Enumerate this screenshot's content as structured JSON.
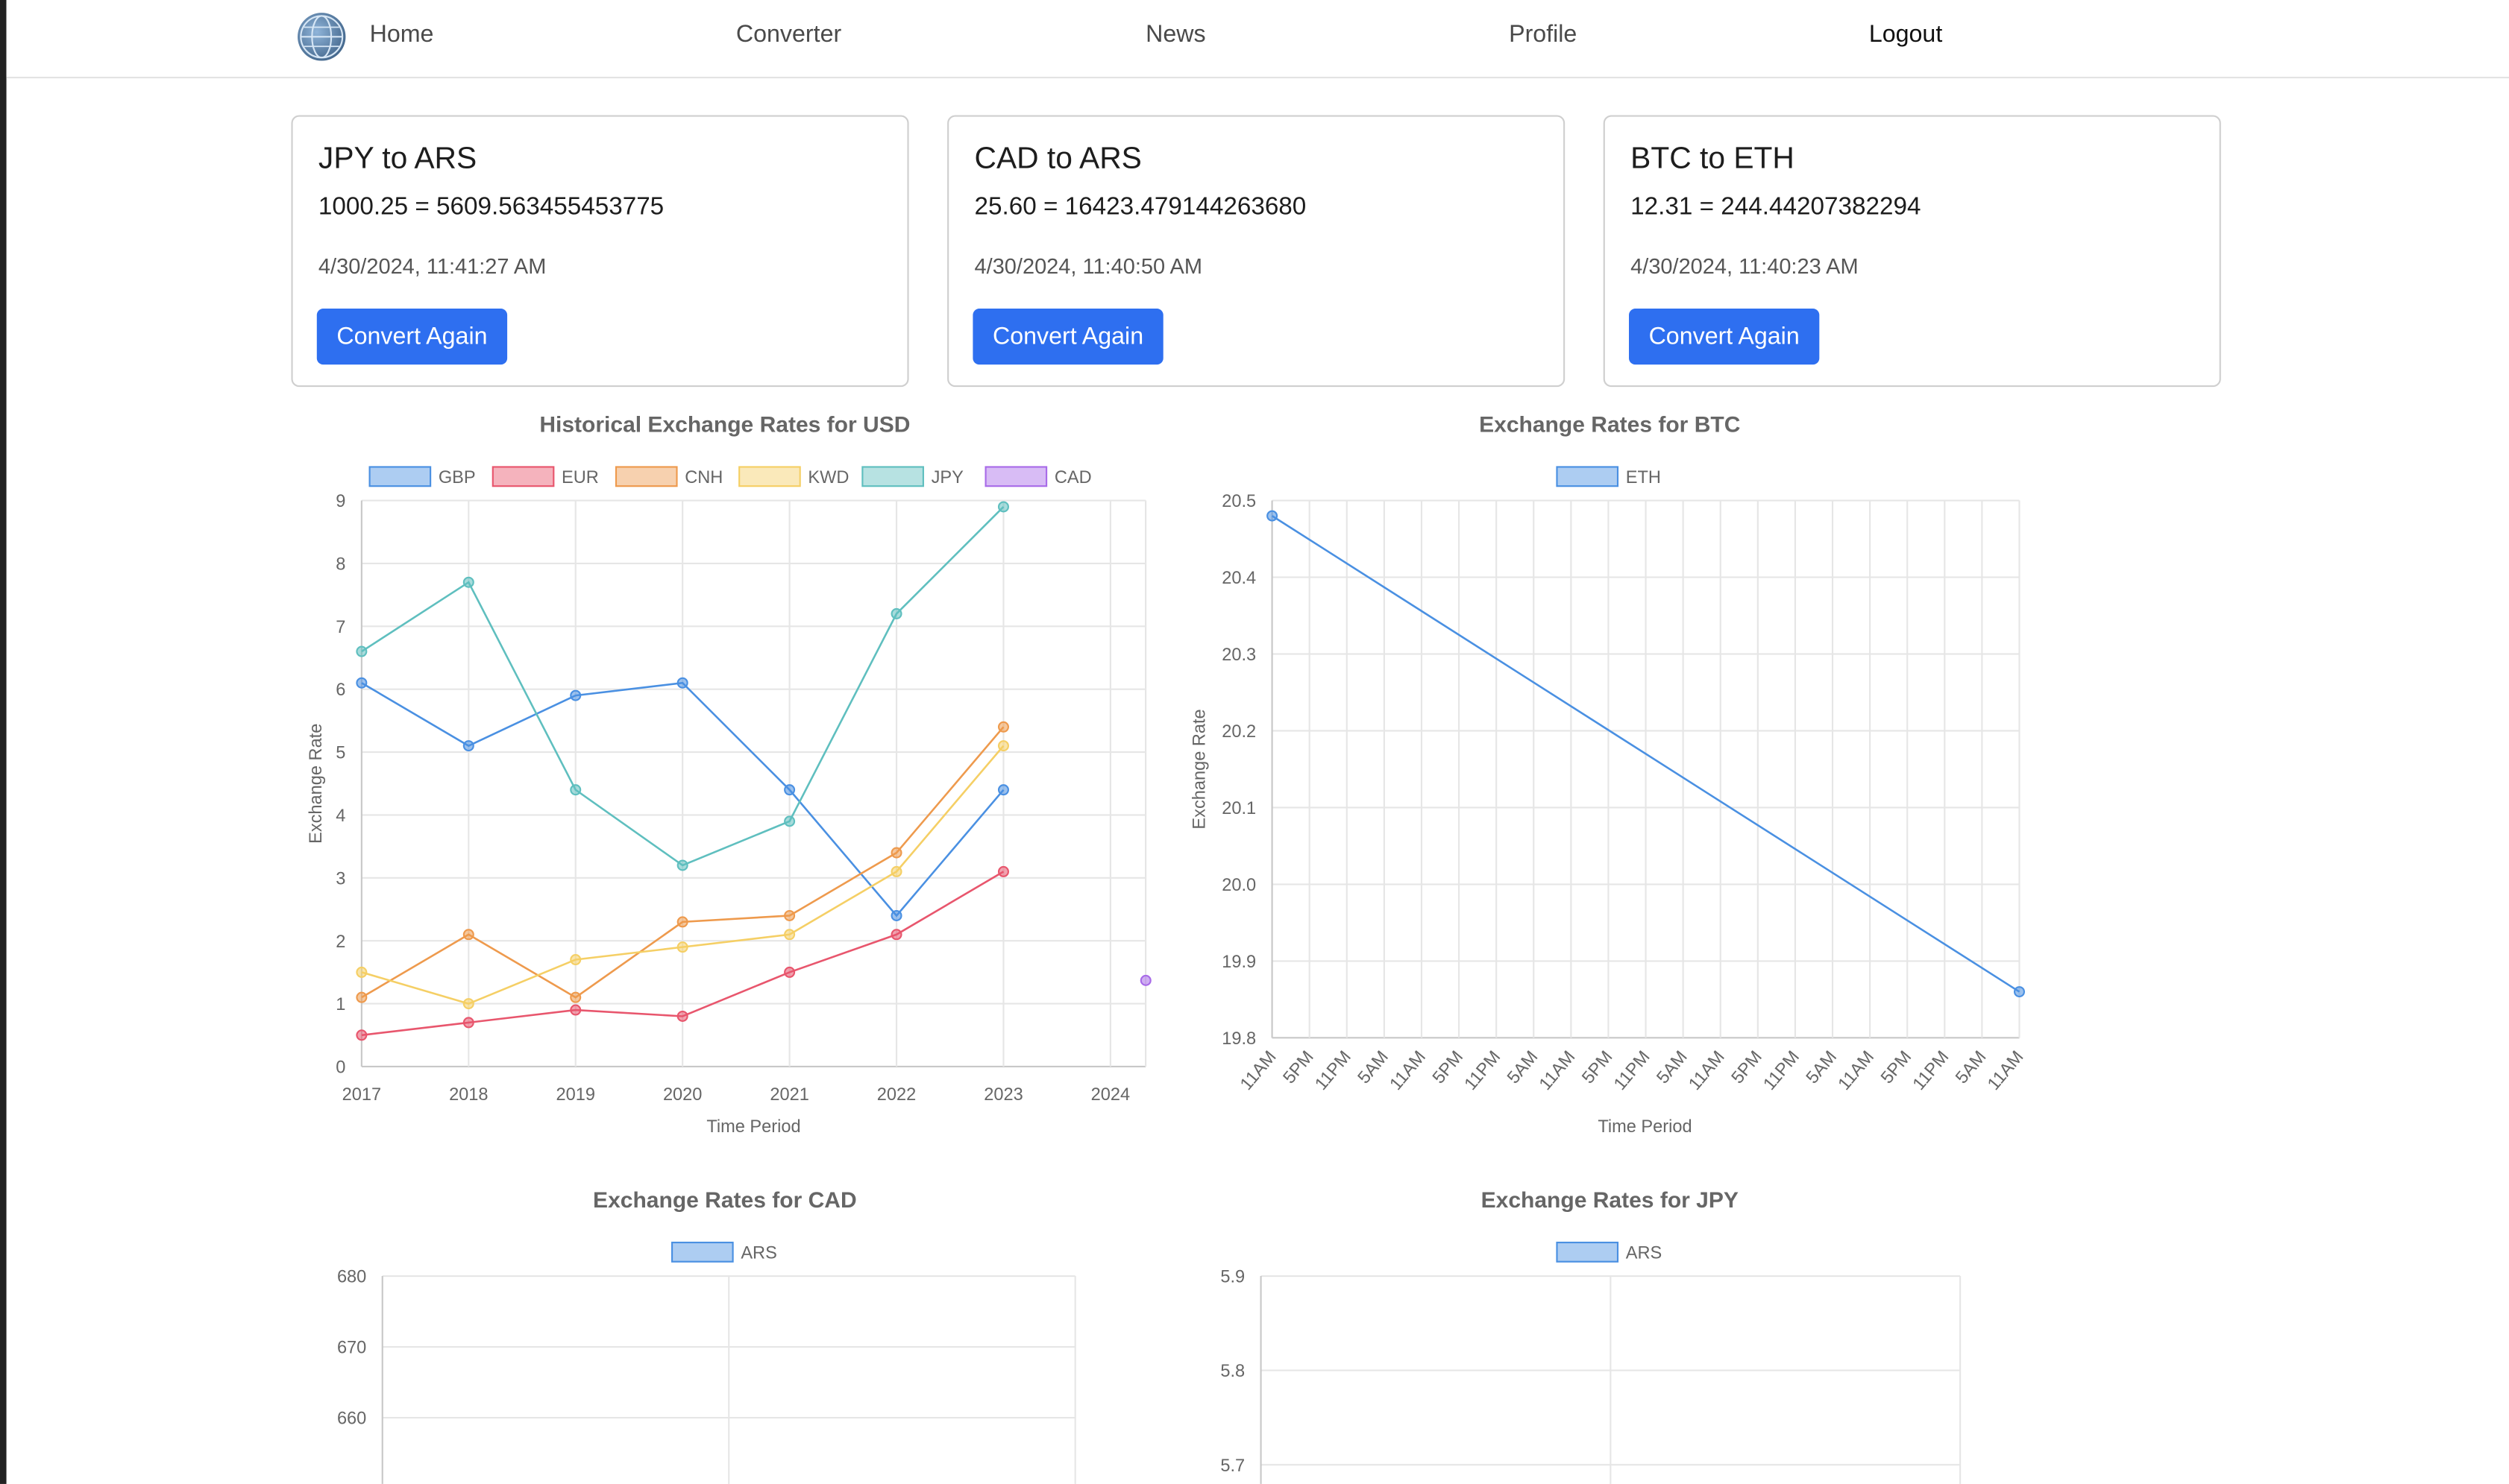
{
  "nav": {
    "items": [
      {
        "label": "Home"
      },
      {
        "label": "Converter"
      },
      {
        "label": "News"
      },
      {
        "label": "Profile"
      },
      {
        "label": "Logout"
      }
    ]
  },
  "cards": [
    {
      "title": "JPY to ARS",
      "result": "1000.25 = 5609.563455453775",
      "time": "4/30/2024, 11:41:27 AM",
      "button": "Convert Again"
    },
    {
      "title": "CAD to ARS",
      "result": "25.60 = 16423.479144263680",
      "time": "4/30/2024, 11:40:50 AM",
      "button": "Convert Again"
    },
    {
      "title": "BTC to ETH",
      "result": "12.31 = 244.44207382294",
      "time": "4/30/2024, 11:40:23 AM",
      "button": "Convert Again"
    }
  ],
  "colors": {
    "accent": "#2e6ff0",
    "GBP": "#4a90e2",
    "EUR": "#e8566d",
    "CNH": "#ee9a4d",
    "KWD": "#f5cf65",
    "JPY": "#5fbfbf",
    "CAD": "#a86be8"
  },
  "chart_data": [
    {
      "type": "line",
      "title": "Historical Exchange Rates for USD",
      "xlabel": "Time Period",
      "ylabel": "Exchange Rate",
      "categories": [
        "2017",
        "2018",
        "2019",
        "2020",
        "2021",
        "2022",
        "2023",
        "2024"
      ],
      "ylim": [
        0,
        9
      ],
      "yticks": [
        "0",
        "1",
        "2",
        "3",
        "4",
        "5",
        "6",
        "7",
        "8",
        "9"
      ],
      "legend": "top",
      "grid": true,
      "series": [
        {
          "name": "GBP",
          "values": [
            6.1,
            5.1,
            5.9,
            6.1,
            4.4,
            2.4,
            4.4,
            null
          ]
        },
        {
          "name": "EUR",
          "values": [
            0.5,
            0.7,
            0.9,
            0.8,
            1.5,
            2.1,
            3.1,
            null
          ]
        },
        {
          "name": "CNH",
          "values": [
            1.1,
            2.1,
            1.1,
            2.3,
            2.4,
            3.4,
            5.4,
            null
          ]
        },
        {
          "name": "KWD",
          "values": [
            1.5,
            1.0,
            1.7,
            1.9,
            2.1,
            3.1,
            5.1,
            null
          ]
        },
        {
          "name": "JPY",
          "values": [
            6.6,
            7.7,
            4.4,
            3.2,
            3.9,
            7.2,
            8.9,
            null
          ]
        },
        {
          "name": "CAD",
          "values": [
            null,
            null,
            null,
            null,
            null,
            null,
            null,
            null
          ],
          "extra_x": 2024.33,
          "extra_y": 1.37
        }
      ]
    },
    {
      "type": "line",
      "title": "Exchange Rates for BTC",
      "xlabel": "Time Period",
      "ylabel": "Exchange Rate",
      "categories": [
        "11AM",
        "5PM",
        "11PM",
        "5AM",
        "11AM",
        "5PM",
        "11PM",
        "5AM",
        "11AM",
        "5PM",
        "11PM",
        "5AM",
        "11AM",
        "5PM",
        "11PM",
        "5AM",
        "11AM",
        "5PM",
        "11PM",
        "5AM",
        "11AM"
      ],
      "ylim": [
        19.8,
        20.5
      ],
      "yticks": [
        "19.8",
        "19.9",
        "20.0",
        "20.1",
        "20.2",
        "20.3",
        "20.4",
        "20.5"
      ],
      "legend": "top",
      "grid": true,
      "series": [
        {
          "name": "ETH",
          "x_index": [
            0,
            20
          ],
          "values": [
            20.48,
            19.86
          ]
        }
      ]
    },
    {
      "type": "line",
      "title": "Exchange Rates for CAD",
      "ylim": [
        650,
        680
      ],
      "yticks": [
        "680",
        "670",
        "660"
      ],
      "legend": "top",
      "grid": true,
      "series": [
        {
          "name": "ARS",
          "values": []
        }
      ]
    },
    {
      "type": "line",
      "title": "Exchange Rates for JPY",
      "ylim": [
        5.7,
        5.9
      ],
      "yticks": [
        "5.9",
        "5.8",
        "5.7"
      ],
      "legend": "top",
      "grid": true,
      "series": [
        {
          "name": "ARS",
          "values": []
        }
      ]
    }
  ]
}
